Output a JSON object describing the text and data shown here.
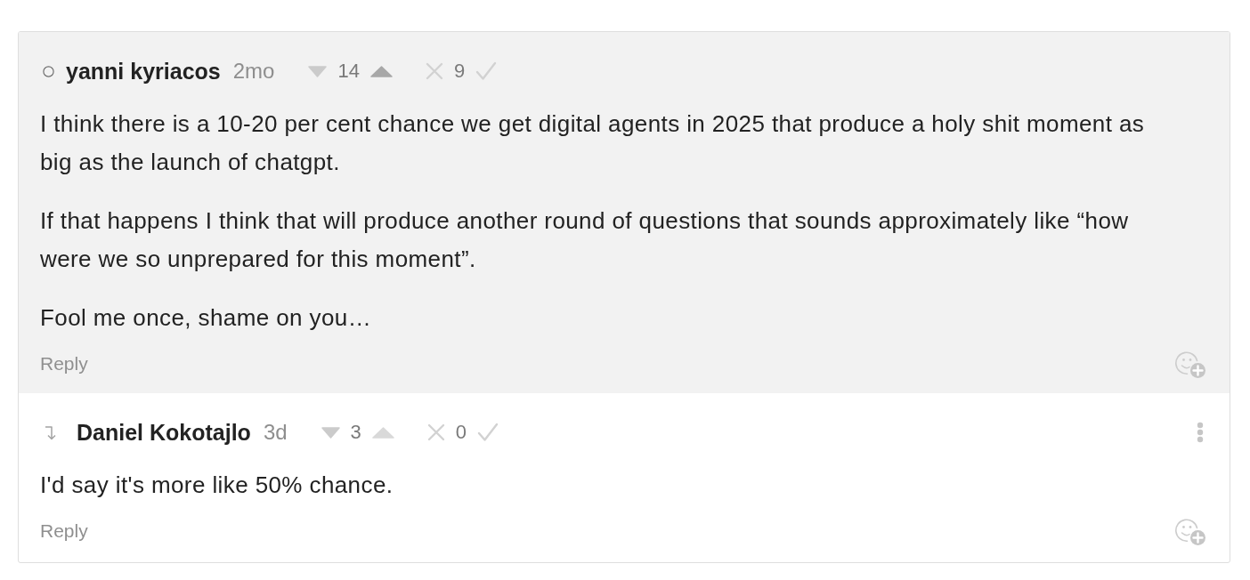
{
  "comments": [
    {
      "kind": "top-level",
      "author": "yanni kyriacos",
      "age": "2mo",
      "karma": "14",
      "upvote_active": true,
      "agreement": "9",
      "menu": false,
      "paragraphs": [
        "I think there is a 10-20 per cent chance we get digital agents in 2025 that produce a holy shit moment as big as the launch of chatgpt.",
        "If that happens I think that will produce another round of questions that sounds approximately like “how were we so unprepared for this moment”.",
        "Fool me once, shame on you…"
      ],
      "reply": "Reply"
    },
    {
      "kind": "reply",
      "author": "Daniel Kokotajlo",
      "age": "3d",
      "karma": "3",
      "upvote_active": false,
      "agreement": "0",
      "menu": true,
      "paragraphs": [
        "I'd say it's more like 50% chance."
      ],
      "reply": "Reply"
    }
  ]
}
